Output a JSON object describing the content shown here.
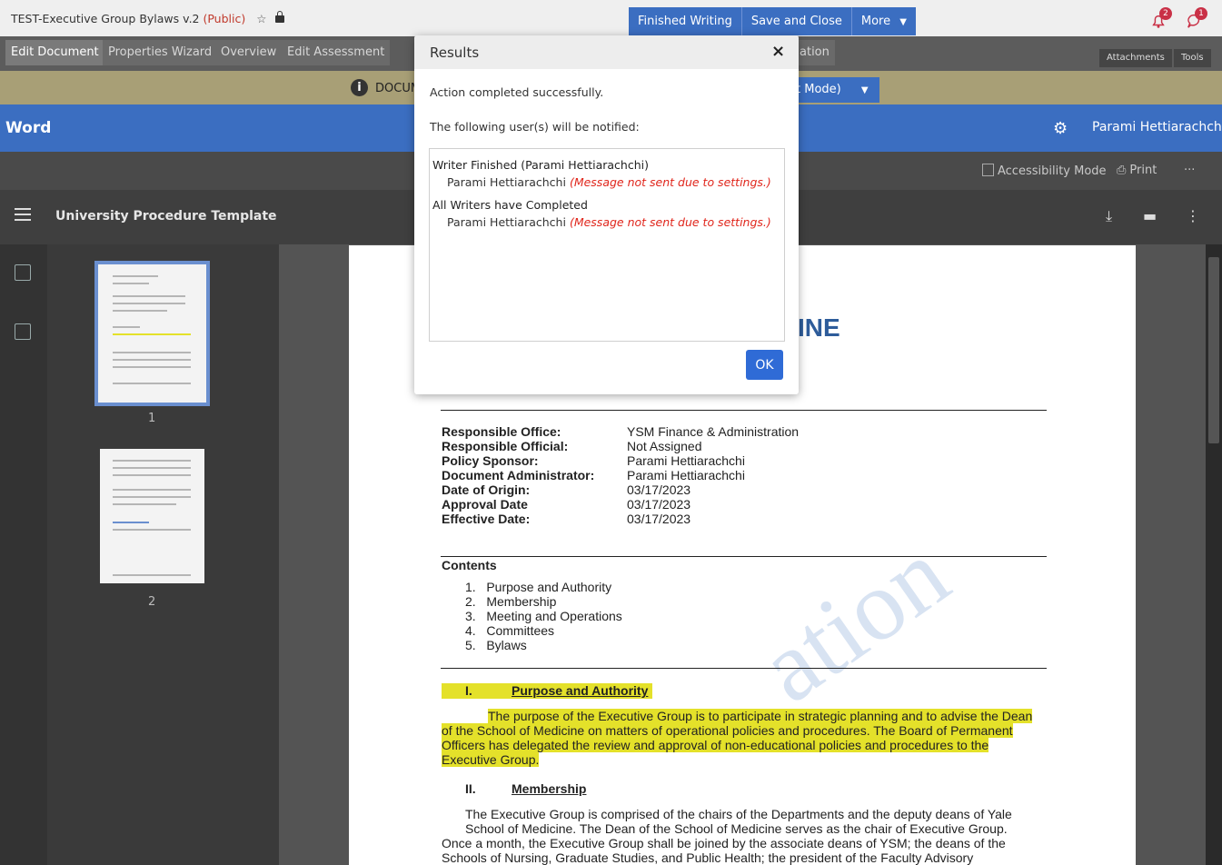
{
  "topbar": {
    "doc_title_prefix": "TEST-Executive Group Bylaws v.2 ",
    "doc_title_status": "(Public)",
    "buttons": [
      "Finished Writing",
      "Save and Close",
      "More"
    ],
    "notifications_count": "2",
    "messages_count": "1"
  },
  "tabs": [
    "Edit Document",
    "Properties Wizard",
    "Overview",
    "Edit Assessment"
  ],
  "tab_partial": "ation",
  "right_tabs": [
    "Attachments",
    "Tools"
  ],
  "infobar": {
    "text": "DOCUM",
    "mode_button": "t Mode)"
  },
  "wordbar": {
    "label": "Word",
    "user": "Parami Hettiarachchi"
  },
  "ribbon": {
    "accessibility": "Accessibility Mode",
    "print": "Print",
    "more": "···"
  },
  "viewer": {
    "title": "University Procedure Template",
    "pages": [
      "1",
      "2"
    ]
  },
  "document": {
    "heading_partial": "INE",
    "fields": [
      {
        "label": "Responsible Office:",
        "value": "YSM Finance & Administration"
      },
      {
        "label": "Responsible Official:",
        "value": "Not Assigned"
      },
      {
        "label": "Policy Sponsor:",
        "value": "Parami Hettiarachchi"
      },
      {
        "label": "Document Administrator:",
        "value": "Parami Hettiarachchi"
      },
      {
        "label": "Date of Origin:",
        "value": "03/17/2023"
      },
      {
        "label": "Approval Date",
        "value": "03/17/2023"
      },
      {
        "label": "Effective Date:",
        "value": "03/17/2023"
      }
    ],
    "contents_title": "Contents",
    "contents": [
      "1.   Purpose and Authority",
      "2.   Membership",
      "3.   Meeting and Operations",
      "4.   Committees",
      "5.   Bylaws"
    ],
    "section1_num": "I.",
    "section1_title": "Purpose and Authority",
    "section1_lines": [
      "The purpose of the Executive Group is to participate in strategic planning and to advise the Dean",
      "of the School of Medicine on matters of operational policies and procedures. The Board of Permanent",
      "Officers has delegated the review and approval of non-educational policies and procedures to the",
      "Executive Group."
    ],
    "section2_num": "II.",
    "section2_title": "Membership",
    "section2_lines": [
      "The Executive Group is comprised of the chairs of the Departments and the deputy deans of Yale",
      "School of Medicine. The Dean of the School of Medicine serves as the chair of Executive Group.",
      "Once a month, the Executive Group shall be joined by the associate deans of YSM; the deans of the",
      "Schools of Nursing, Graduate Studies, and Public Health; the president of the Faculty Advisory"
    ]
  },
  "modal": {
    "title": "Results",
    "close": "×",
    "success": "Action completed successfully.",
    "notified": "The following user(s) will be notified:",
    "groups": [
      {
        "title": "Writer Finished (Parami Hettiarachchi)",
        "user": "Parami Hettiarachchi",
        "note": "(Message not sent due to settings.)"
      },
      {
        "title": "All Writers have Completed",
        "user": "Parami Hettiarachchi",
        "note": "(Message not sent due to settings.)"
      }
    ],
    "ok": "OK"
  }
}
